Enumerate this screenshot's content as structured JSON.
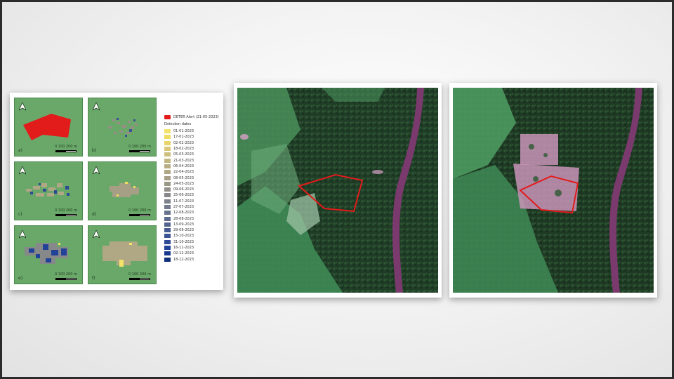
{
  "panels": [
    {
      "letter": "a)",
      "scale": "0   100 200 m"
    },
    {
      "letter": "b)",
      "scale": "0   100 200 m"
    },
    {
      "letter": "c)",
      "scale": "0   100 200 m"
    },
    {
      "letter": "d)",
      "scale": "0   100 200 m"
    },
    {
      "letter": "e)",
      "scale": "0   100 200 m"
    },
    {
      "letter": "f)",
      "scale": "0   100 200 m"
    }
  ],
  "legend": {
    "alert_label": "DETER Alert (21-05-2023)",
    "title": "Detection dates",
    "entries": [
      {
        "date": "01-01-2023",
        "color": "#f4e36a"
      },
      {
        "date": "17-01-2023",
        "color": "#f0dc60"
      },
      {
        "date": "02-02-2023",
        "color": "#e8d46a"
      },
      {
        "date": "18-02-2023",
        "color": "#d9c878"
      },
      {
        "date": "05-03-2023",
        "color": "#cdbf7c"
      },
      {
        "date": "21-03-2023",
        "color": "#c3b680"
      },
      {
        "date": "06-04-2023",
        "color": "#b9ae82"
      },
      {
        "date": "22-04-2023",
        "color": "#b0a784"
      },
      {
        "date": "08-05-2023",
        "color": "#a69f86"
      },
      {
        "date": "24-05-2023",
        "color": "#9b9787"
      },
      {
        "date": "09-06-2023",
        "color": "#918f88"
      },
      {
        "date": "25-06-2023",
        "color": "#878889"
      },
      {
        "date": "11-07-2023",
        "color": "#7d818a"
      },
      {
        "date": "27-07-2023",
        "color": "#737a8c"
      },
      {
        "date": "12-08-2023",
        "color": "#69738d"
      },
      {
        "date": "28-08-2023",
        "color": "#5e6b8f"
      },
      {
        "date": "13-09-2023",
        "color": "#536390"
      },
      {
        "date": "29-09-2023",
        "color": "#475b92"
      },
      {
        "date": "15-10-2023",
        "color": "#3b5294"
      },
      {
        "date": "31-10-2023",
        "color": "#2e4a96"
      },
      {
        "date": "16-11-2023",
        "color": "#224298"
      },
      {
        "date": "02-12-2023",
        "color": "#173a8f"
      },
      {
        "date": "18-12-2023",
        "color": "#0e2f7a"
      }
    ]
  },
  "colors": {
    "alert_red": "#e21b1b",
    "map_green": "#6aa86a",
    "forest_dark": "#1f3a24",
    "river": "#7b3a6e",
    "clearing_pink": "#d9a0c8"
  }
}
